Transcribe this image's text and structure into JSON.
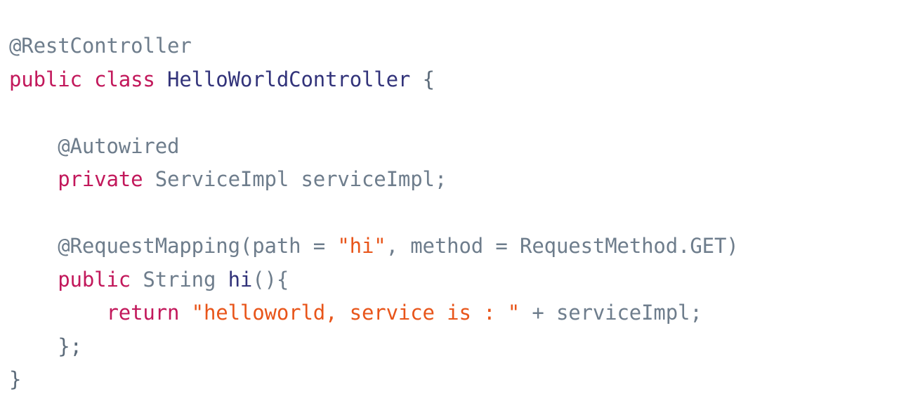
{
  "document": {
    "language": "java",
    "background_color": "#ffffff",
    "palette": {
      "plain": "#6e7d8c",
      "keyword": "#c2185b",
      "type": "#32337a",
      "string": "#e8551a",
      "brace": "#5c6b7a"
    },
    "plain_text": "@RestController\npublic class HelloWorldController {\n\n    @Autowired\n    private ServiceImpl serviceImpl;\n\n    @RequestMapping(path = \"hi\", method = RequestMethod.GET)\n    public String hi(){\n        return \"helloworld, service is : \" + serviceImpl;\n    };\n}"
  },
  "lines": [
    {
      "number": 1,
      "tokens": [
        {
          "text": "@RestController",
          "kind": "anno"
        }
      ]
    },
    {
      "number": 2,
      "tokens": [
        {
          "text": "public",
          "kind": "keyword"
        },
        {
          "text": " ",
          "kind": "plain"
        },
        {
          "text": "class",
          "kind": "keyword"
        },
        {
          "text": " ",
          "kind": "plain"
        },
        {
          "text": "HelloWorldController",
          "kind": "type"
        },
        {
          "text": " ",
          "kind": "plain"
        },
        {
          "text": "{",
          "kind": "brace"
        }
      ]
    },
    {
      "number": 3,
      "tokens": []
    },
    {
      "number": 4,
      "tokens": [
        {
          "text": "    ",
          "kind": "plain"
        },
        {
          "text": "@Autowired",
          "kind": "anno"
        }
      ]
    },
    {
      "number": 5,
      "tokens": [
        {
          "text": "    ",
          "kind": "plain"
        },
        {
          "text": "private",
          "kind": "keyword"
        },
        {
          "text": " ",
          "kind": "plain"
        },
        {
          "text": "ServiceImpl serviceImpl;",
          "kind": "plain"
        }
      ]
    },
    {
      "number": 6,
      "tokens": []
    },
    {
      "number": 7,
      "tokens": [
        {
          "text": "    ",
          "kind": "plain"
        },
        {
          "text": "@RequestMapping(path = ",
          "kind": "plain"
        },
        {
          "text": "\"hi\"",
          "kind": "string"
        },
        {
          "text": ", method = RequestMethod.GET)",
          "kind": "plain"
        }
      ]
    },
    {
      "number": 8,
      "tokens": [
        {
          "text": "    ",
          "kind": "plain"
        },
        {
          "text": "public",
          "kind": "keyword"
        },
        {
          "text": " ",
          "kind": "plain"
        },
        {
          "text": "String",
          "kind": "plain"
        },
        {
          "text": " ",
          "kind": "plain"
        },
        {
          "text": "hi",
          "kind": "type"
        },
        {
          "text": "(){",
          "kind": "plain"
        }
      ]
    },
    {
      "number": 9,
      "tokens": [
        {
          "text": "        ",
          "kind": "plain"
        },
        {
          "text": "return",
          "kind": "keyword"
        },
        {
          "text": " ",
          "kind": "plain"
        },
        {
          "text": "\"helloworld, service is : \"",
          "kind": "string"
        },
        {
          "text": " + serviceImpl;",
          "kind": "plain"
        }
      ]
    },
    {
      "number": 10,
      "tokens": [
        {
          "text": "    ",
          "kind": "plain"
        },
        {
          "text": "};",
          "kind": "brace"
        }
      ]
    },
    {
      "number": 11,
      "tokens": [
        {
          "text": "}",
          "kind": "brace"
        }
      ]
    }
  ]
}
